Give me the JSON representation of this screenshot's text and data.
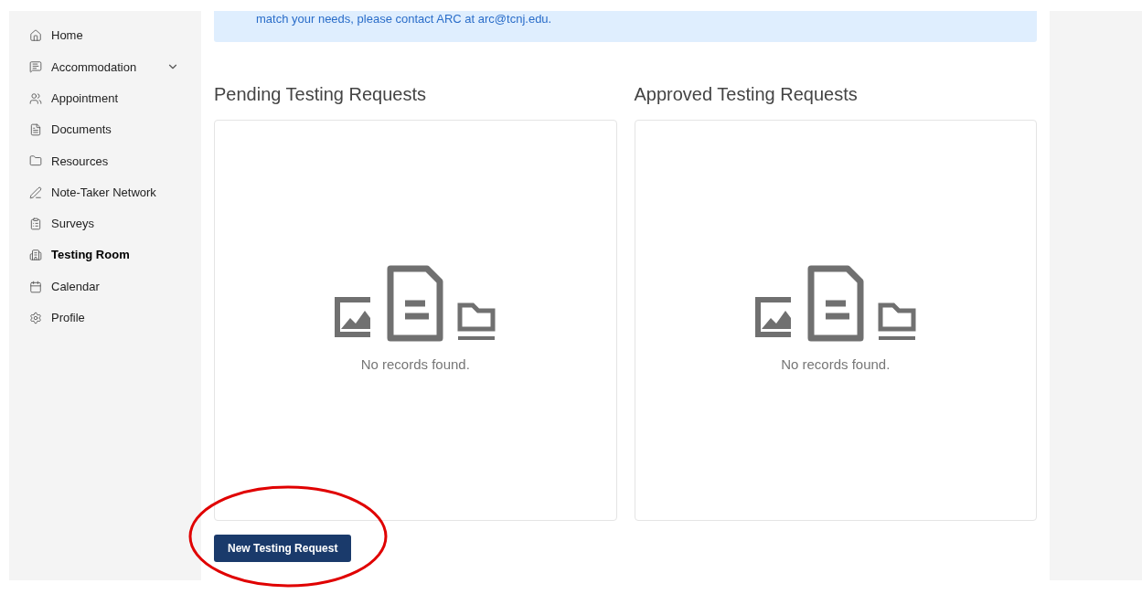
{
  "sidebar": {
    "items": [
      {
        "label": "Home",
        "selected": false,
        "has_submenu": false
      },
      {
        "label": "Accommodation",
        "selected": false,
        "has_submenu": true
      },
      {
        "label": "Appointment",
        "selected": false,
        "has_submenu": false
      },
      {
        "label": "Documents",
        "selected": false,
        "has_submenu": false
      },
      {
        "label": "Resources",
        "selected": false,
        "has_submenu": false
      },
      {
        "label": "Note-Taker Network",
        "selected": false,
        "has_submenu": false
      },
      {
        "label": "Surveys",
        "selected": false,
        "has_submenu": false
      },
      {
        "label": "Testing Room",
        "selected": true,
        "has_submenu": false
      },
      {
        "label": "Calendar",
        "selected": false,
        "has_submenu": false
      },
      {
        "label": "Profile",
        "selected": false,
        "has_submenu": false
      }
    ]
  },
  "notice": {
    "text": "match your needs, please contact ARC at arc@tcnj.edu."
  },
  "panels": [
    {
      "title": "Pending Testing Requests",
      "empty_message": "No records found."
    },
    {
      "title": "Approved Testing Requests",
      "empty_message": "No records found."
    }
  ],
  "new_request_button": {
    "label": "New Testing Request",
    "highlighted": true
  }
}
